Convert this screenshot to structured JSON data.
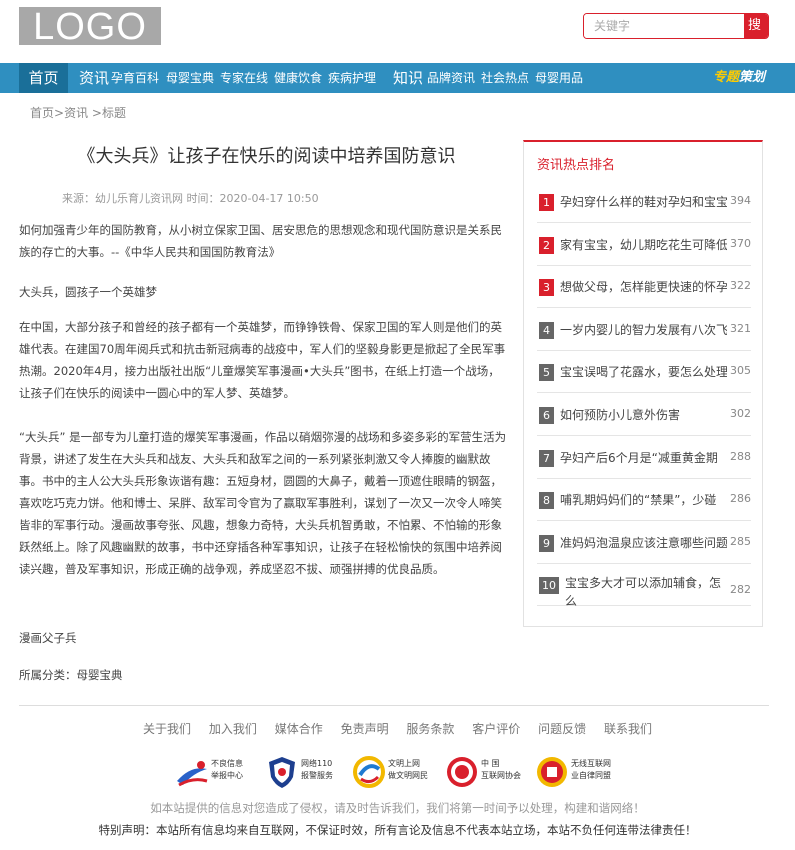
{
  "header": {
    "logo": "LOGO",
    "search": {
      "placeholder": "关键字",
      "button": "搜 索"
    }
  },
  "nav": {
    "home": "首页",
    "section1": "资讯",
    "items1": [
      "孕育百科",
      "母婴宝典",
      "专家在线",
      "健康饮食",
      "疾病护理"
    ],
    "section2": "知识",
    "items2": [
      "品牌资讯",
      "社会热点",
      "母婴用品"
    ],
    "special_a": "专题",
    "special_b": "策划"
  },
  "breadcrumb": [
    "首页",
    "资讯",
    "标题"
  ],
  "article": {
    "title": "《大头兵》让孩子在快乐的阅读中培养国防意识",
    "meta": "来源：幼儿乐育儿资讯网 时间：2020-04-17 10:50",
    "paragraphs": [
      "如何加强青少年的国防教育，从小树立保家卫国、居安思危的思想观念和现代国防意识是关系民族的存亡的大事。--《中华人民共和国国防教育法》",
      "大头兵，圆孩子一个英雄梦",
      "在中国，大部分孩子和曾经的孩子都有一个英雄梦，而铮铮铁骨、保家卫国的军人则是他们的英雄代表。在建国70周年阅兵式和抗击新冠病毒的战疫中，军人们的坚毅身影更是掀起了全民军事热潮。2020年4月，接力出版社出版“儿童爆笑军事漫画•大头兵”图书，在纸上打造一个战场，让孩子们在快乐的阅读中一圆心中的军人梦、英雄梦。",
      "“大头兵” 是一部专为儿童打造的爆笑军事漫画，作品以硝烟弥漫的战场和多姿多彩的军营生活为背景，讲述了发生在大头兵和战友、大头兵和敌军之间的一系列紧张刺激又令人捧腹的幽默故事。书中的主人公大头兵形象诙谐有趣：五短身材，圆圆的大鼻子，戴着一顶遮住眼睛的钢盔，喜欢吃巧克力饼。他和博士、呆胖、敌军司令官为了赢取军事胜利，谋划了一次又一次令人啼笑皆非的军事行动。漫画故事夸张、风趣，想象力奇特，大头兵机智勇敢，不怕累、不怕输的形象跃然纸上。除了风趣幽默的故事，书中还穿插各种军事知识，让孩子在轻松愉快的氛围中培养阅读兴趣，普及军事知识，形成正确的战争观，养成坚忍不拔、顽强拼搏的优良品质。",
      "漫画父子兵",
      "所属分类：母婴宝典"
    ]
  },
  "sidebar": {
    "title": "资讯热点排名",
    "items": [
      {
        "rank": "1",
        "text": "孕妇穿什么样的鞋对孕妇和宝宝",
        "count": "394",
        "color": "#d9202c"
      },
      {
        "rank": "2",
        "text": "家有宝宝，幼儿期吃花生可降低",
        "count": "370",
        "color": "#d9202c"
      },
      {
        "rank": "3",
        "text": "想做父母，怎样能更快速的怀孕",
        "count": "322",
        "color": "#d9202c"
      },
      {
        "rank": "4",
        "text": "一岁内婴儿的智力发展有八次飞",
        "count": "321",
        "color": "#666666"
      },
      {
        "rank": "5",
        "text": "宝宝误喝了花露水，要怎么处理",
        "count": "305",
        "color": "#666666"
      },
      {
        "rank": "6",
        "text": "如何预防小儿意外伤害",
        "count": "302",
        "color": "#666666"
      },
      {
        "rank": "7",
        "text": "孕妇产后6个月是“减重黄金期",
        "count": "288",
        "color": "#666666"
      },
      {
        "rank": "8",
        "text": "哺乳期妈妈们的“禁果”，少碰",
        "count": "286",
        "color": "#666666"
      },
      {
        "rank": "9",
        "text": "准妈妈泡温泉应该注意哪些问题",
        "count": "285",
        "color": "#666666"
      },
      {
        "rank": "10",
        "text": "宝宝多大才可以添加辅食，怎么",
        "count": "282",
        "color": "#666666"
      }
    ]
  },
  "footer": {
    "links": [
      "关于我们",
      "加入我们",
      "媒体合作",
      "免责声明",
      "服务条款",
      "客户评价",
      "问题反馈",
      "联系我们"
    ],
    "badges": [
      {
        "line1": "不良信息",
        "line2": "举报中心"
      },
      {
        "line1": "网络110",
        "line2": "报警服务"
      },
      {
        "line1": "文明上网",
        "line2": "做文明网民"
      },
      {
        "line1": "中 国",
        "line2": "互联网协会"
      },
      {
        "line1": "无线互联网",
        "line2": "业自律同盟"
      }
    ],
    "disclaimer1": "如本站提供的信息对您造成了侵权，请及时告诉我们，我们将第一时间予以处理，构建和谐网络！",
    "disclaimer2": "特别声明：本站所有信息均来自互联网，不保证时效，所有言论及信息不代表本站立场，本站不负任何连带法律责任！"
  },
  "colors": {
    "accent": "#d9202c",
    "nav": "#2f8fc0",
    "nav_active": "#1a6f99"
  }
}
